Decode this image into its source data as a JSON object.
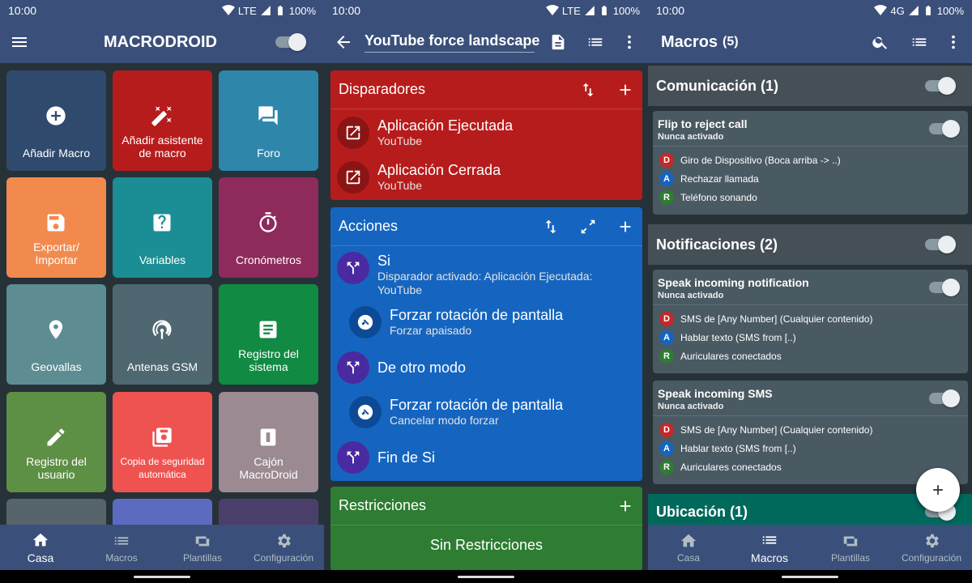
{
  "status": {
    "time": "10:00",
    "net1": "LTE",
    "net2": "LTE",
    "net3": "4G",
    "battery": "100%"
  },
  "home": {
    "title": "MACRODROID",
    "tiles": [
      {
        "label": "Añadir Macro",
        "icon": "add-circle-icon",
        "color": "#304a6e"
      },
      {
        "label": "Añadir asistente de macro",
        "icon": "magic-wand-icon",
        "color": "#b71c1c"
      },
      {
        "label": "Foro",
        "icon": "forum-icon",
        "color": "#2e86ab"
      },
      {
        "label": "Exportar/ Importar",
        "icon": "save-icon",
        "color": "#f28a4e"
      },
      {
        "label": "Variables",
        "icon": "question-icon",
        "color": "#1a8e94"
      },
      {
        "label": "Cronómetros",
        "icon": "timer-icon",
        "color": "#8e2a5c"
      },
      {
        "label": "Geovallas",
        "icon": "location-icon",
        "color": "#5d8d93"
      },
      {
        "label": "Antenas GSM",
        "icon": "antenna-icon",
        "color": "#4f6771"
      },
      {
        "label": "Registro del sistema",
        "icon": "log-icon",
        "color": "#118a43"
      },
      {
        "label": "Registro del usuario",
        "icon": "user-log-icon",
        "color": "#5d8f45"
      },
      {
        "label": "Copia de seguridad automática",
        "icon": "backup-icon",
        "color": "#ef5350"
      },
      {
        "label": "Cajón MacroDroid",
        "icon": "drawer-icon",
        "color": "#9b8a91"
      }
    ]
  },
  "nav": {
    "home": "Casa",
    "macros": "Macros",
    "templates": "Plantillas",
    "settings": "Configuración"
  },
  "editor": {
    "macro_name": "YouTube force landscape",
    "triggers": {
      "title": "Disparadores",
      "items": [
        {
          "title": "Aplicación Ejecutada",
          "sub": "YouTube"
        },
        {
          "title": "Aplicación Cerrada",
          "sub": "YouTube"
        }
      ]
    },
    "actions": {
      "title": "Acciones",
      "if_title": "Si",
      "if_sub": "Disparador activado: Aplicación Ejecutada: YouTube",
      "rot1_title": "Forzar rotación de pantalla",
      "rot1_sub": "Forzar apaisado",
      "else_title": "De otro modo",
      "rot2_title": "Forzar rotación de pantalla",
      "rot2_sub": "Cancelar modo forzar",
      "endif_title": "Fin de Si"
    },
    "constraints": {
      "title": "Restricciones",
      "empty": "Sin Restricciones"
    }
  },
  "macros": {
    "title": "Macros",
    "count": "(5)",
    "categories": [
      {
        "name": "Comunicación (1)"
      },
      {
        "name": "Notificaciones (2)"
      },
      {
        "name": "Ubicación (1)"
      }
    ],
    "cards": [
      {
        "name": "Flip to reject call",
        "status": "Nunca activado",
        "lines": [
          {
            "badge": "D",
            "text": "Giro de Dispositivo (Boca arriba -> ..)"
          },
          {
            "badge": "A",
            "text": "Rechazar llamada"
          },
          {
            "badge": "R",
            "text": "Teléfono sonando"
          }
        ]
      },
      {
        "name": "Speak incoming notification",
        "status": "Nunca activado",
        "lines": [
          {
            "badge": "D",
            "text": "SMS de [Any Number] (Cualquier contenido)"
          },
          {
            "badge": "A",
            "text": "Hablar texto (SMS from [..)"
          },
          {
            "badge": "R",
            "text": "Auriculares conectados"
          }
        ]
      },
      {
        "name": "Speak incoming SMS",
        "status": "Nunca activado",
        "lines": [
          {
            "badge": "D",
            "text": "SMS de [Any Number] (Cualquier contenido)"
          },
          {
            "badge": "A",
            "text": "Hablar texto (SMS from [..)"
          },
          {
            "badge": "R",
            "text": "Auriculares conectados"
          }
        ]
      }
    ]
  },
  "colors": {
    "triggers": "#b71c1c",
    "actions": "#1565c0",
    "constraints": "#2e7d32",
    "app_bar": "#3a4f7a",
    "badge_d": "#c62828",
    "badge_a": "#1565c0",
    "badge_r": "#2e7d32"
  }
}
